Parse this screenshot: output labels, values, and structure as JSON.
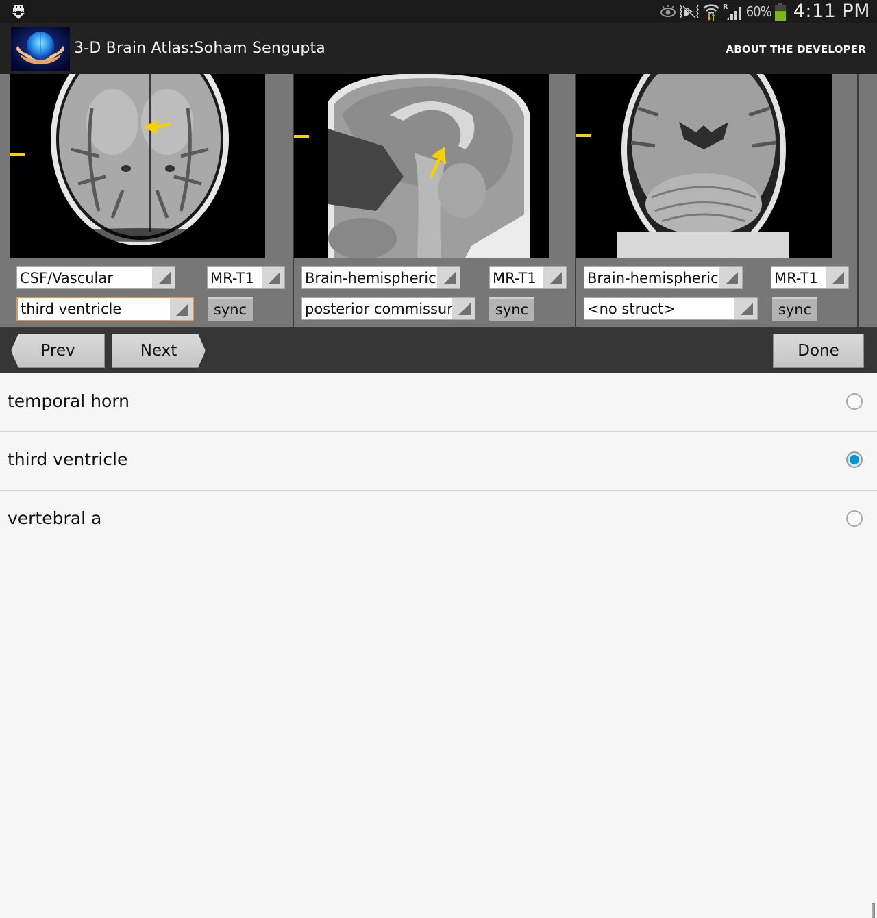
{
  "status_bar": {
    "battery_percent": "60%",
    "battery_level": 0.6,
    "time": "4:11 PM",
    "network_roaming_label": "R",
    "icons": [
      "download-notification-icon",
      "eye-icon",
      "vibrate-mute-icon",
      "wifi-icon",
      "signal-icon",
      "battery-icon"
    ]
  },
  "action_bar": {
    "title": "3-D Brain Atlas:Soham Sengupta",
    "about_label": "ABOUT THE DEVELOPER"
  },
  "panels": [
    {
      "view": "axial",
      "category": "CSF/Vascular",
      "modality": "MR-T1",
      "structure": "third ventricle",
      "sync_label": "sync",
      "structure_focused": true
    },
    {
      "view": "sagittal",
      "category": "Brain-hemispheric",
      "modality": "MR-T1",
      "structure": "posterior commissure",
      "sync_label": "sync",
      "structure_focused": false
    },
    {
      "view": "coronal",
      "category": "Brain-hemispheric",
      "modality": "MR-T1",
      "structure": "<no struct>",
      "sync_label": "sync",
      "structure_focused": false
    }
  ],
  "nav": {
    "prev_label": "Prev",
    "next_label": "Next",
    "done_label": "Done"
  },
  "structure_list": {
    "items": [
      {
        "label": "temporal horn",
        "selected": false
      },
      {
        "label": "third ventricle",
        "selected": true
      },
      {
        "label": "vertebral a",
        "selected": false
      }
    ]
  },
  "colors": {
    "marker_yellow": "#f7d000",
    "radio_selected": "#0c96d1",
    "focus_border": "#d89a5c"
  }
}
